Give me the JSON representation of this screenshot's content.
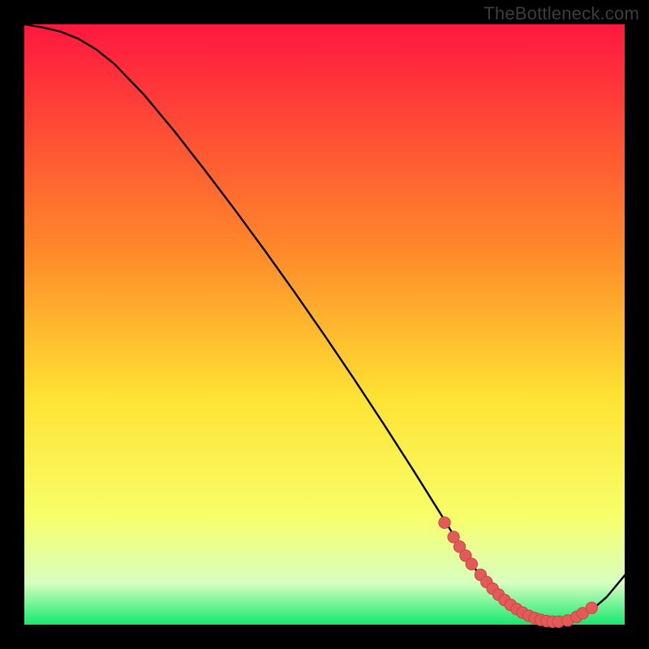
{
  "watermark": "TheBottleneck.com",
  "colors": {
    "black": "#000000",
    "curve_stroke": "#000000",
    "marker_fill": "#e35a5a",
    "marker_stroke": "#c94848",
    "grad_top": "#ff173f",
    "grad_mid1": "#ff8a2a",
    "grad_mid2": "#ffe233",
    "grad_mid3": "#f7ff6a",
    "grad_mid4": "#d8ffc0",
    "grad_bottom": "#17e86f"
  },
  "chart_data": {
    "type": "line",
    "title": "",
    "xlabel": "",
    "ylabel": "",
    "xlim": [
      0,
      100
    ],
    "ylim": [
      0,
      100
    ],
    "x": [
      0,
      3,
      6,
      9,
      12,
      15,
      20,
      25,
      30,
      35,
      40,
      45,
      50,
      55,
      60,
      65,
      70,
      73,
      76,
      79,
      82,
      85,
      88,
      91,
      94,
      97,
      100
    ],
    "y": [
      100,
      99.5,
      98.8,
      97.6,
      95.8,
      93.4,
      88.2,
      82.2,
      75.8,
      69.2,
      62.4,
      55.4,
      48.2,
      40.8,
      33.2,
      25.4,
      17.4,
      12.4,
      8,
      4.4,
      1.8,
      0.6,
      0.2,
      0.6,
      2,
      4.6,
      8.2
    ],
    "markers_x": [
      70,
      71.5,
      72.5,
      73.5,
      74.5,
      76,
      77,
      78,
      79,
      80,
      81,
      82,
      83,
      84,
      85,
      86,
      87,
      88,
      89,
      90.5,
      92,
      93,
      94.5
    ],
    "markers_y": [
      17.0,
      14.6,
      13.0,
      11.5,
      10.1,
      8.3,
      7.1,
      6.0,
      5.0,
      4.1,
      3.3,
      2.6,
      2.0,
      1.5,
      1.1,
      0.8,
      0.6,
      0.5,
      0.5,
      0.7,
      1.3,
      1.9,
      2.8
    ]
  }
}
